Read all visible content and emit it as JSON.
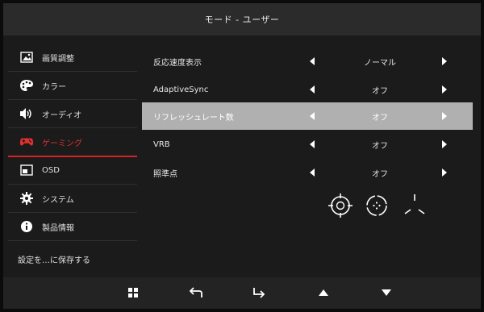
{
  "title": "モード - ユーザー",
  "sidebar": {
    "items": [
      {
        "label": "画質調整",
        "icon": "image-icon"
      },
      {
        "label": "カラー",
        "icon": "palette-icon"
      },
      {
        "label": "オーディオ",
        "icon": "speaker-icon"
      },
      {
        "label": "ゲーミング",
        "icon": "gamepad-icon",
        "active": true
      },
      {
        "label": "OSD",
        "icon": "osd-icon"
      },
      {
        "label": "システム",
        "icon": "gear-icon"
      },
      {
        "label": "製品情報",
        "icon": "info-icon"
      }
    ],
    "save_label": "設定を…に保存する"
  },
  "settings": [
    {
      "label": "反応速度表示",
      "value": "ノーマル"
    },
    {
      "label": "AdaptiveSync",
      "value": "オフ"
    },
    {
      "label": "リフレッシュレート数",
      "value": "オフ",
      "selected": true
    },
    {
      "label": "VRB",
      "value": "オフ"
    },
    {
      "label": "照準点",
      "value": "オフ"
    }
  ],
  "crosshair_options": [
    "crosshair-circle-icon",
    "crosshair-dots-icon",
    "crosshair-tri-icon"
  ],
  "bottom_buttons": [
    "menu-grid-icon",
    "back-icon",
    "enter-icon",
    "up-arrow-icon",
    "down-arrow-icon"
  ],
  "colors": {
    "accent": "#d32526",
    "selected_row": "#b0b0b0",
    "panel": "#1b1b1b"
  }
}
